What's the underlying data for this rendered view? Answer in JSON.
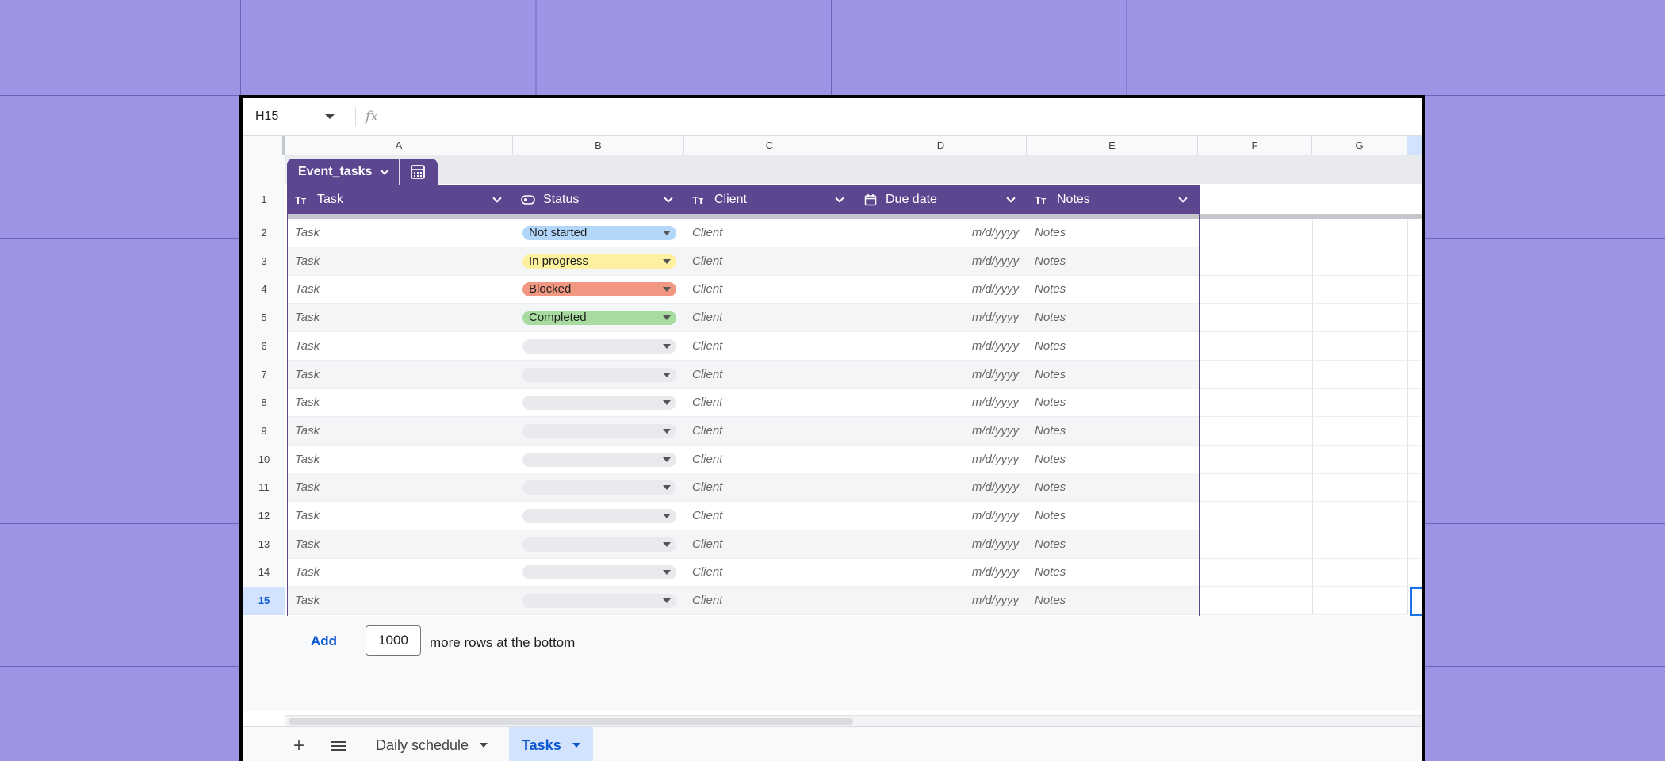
{
  "name_box": "H15",
  "formula_label": "fx",
  "columns": [
    "A",
    "B",
    "C",
    "D",
    "E",
    "F",
    "G"
  ],
  "table": {
    "name": "Event_tasks",
    "header_color": "#5c4690",
    "headers": [
      {
        "icon": "text-type-icon",
        "label": "Task"
      },
      {
        "icon": "chip-type-icon",
        "label": "Status"
      },
      {
        "icon": "text-type-icon",
        "label": "Client"
      },
      {
        "icon": "calendar-icon",
        "label": "Due date"
      },
      {
        "icon": "text-type-icon",
        "label": "Notes"
      }
    ],
    "header_row_num": "1",
    "rows": [
      {
        "num": "2",
        "task": "Task",
        "status": "Not started",
        "status_color": "#b3d7fb",
        "client": "Client",
        "due": "m/d/yyyy",
        "notes": "Notes"
      },
      {
        "num": "3",
        "task": "Task",
        "status": "In progress",
        "status_color": "#fdf19f",
        "client": "Client",
        "due": "m/d/yyyy",
        "notes": "Notes"
      },
      {
        "num": "4",
        "task": "Task",
        "status": "Blocked",
        "status_color": "#f29882",
        "client": "Client",
        "due": "m/d/yyyy",
        "notes": "Notes"
      },
      {
        "num": "5",
        "task": "Task",
        "status": "Completed",
        "status_color": "#a8dba0",
        "client": "Client",
        "due": "m/d/yyyy",
        "notes": "Notes"
      },
      {
        "num": "6",
        "task": "Task",
        "status": "",
        "status_color": "#e8eaed",
        "client": "Client",
        "due": "m/d/yyyy",
        "notes": "Notes"
      },
      {
        "num": "7",
        "task": "Task",
        "status": "",
        "status_color": "#e8eaed",
        "client": "Client",
        "due": "m/d/yyyy",
        "notes": "Notes"
      },
      {
        "num": "8",
        "task": "Task",
        "status": "",
        "status_color": "#e8eaed",
        "client": "Client",
        "due": "m/d/yyyy",
        "notes": "Notes"
      },
      {
        "num": "9",
        "task": "Task",
        "status": "",
        "status_color": "#e8eaed",
        "client": "Client",
        "due": "m/d/yyyy",
        "notes": "Notes"
      },
      {
        "num": "10",
        "task": "Task",
        "status": "",
        "status_color": "#e8eaed",
        "client": "Client",
        "due": "m/d/yyyy",
        "notes": "Notes"
      },
      {
        "num": "11",
        "task": "Task",
        "status": "",
        "status_color": "#e8eaed",
        "client": "Client",
        "due": "m/d/yyyy",
        "notes": "Notes"
      },
      {
        "num": "12",
        "task": "Task",
        "status": "",
        "status_color": "#e8eaed",
        "client": "Client",
        "due": "m/d/yyyy",
        "notes": "Notes"
      },
      {
        "num": "13",
        "task": "Task",
        "status": "",
        "status_color": "#e8eaed",
        "client": "Client",
        "due": "m/d/yyyy",
        "notes": "Notes"
      },
      {
        "num": "14",
        "task": "Task",
        "status": "",
        "status_color": "#e8eaed",
        "client": "Client",
        "due": "m/d/yyyy",
        "notes": "Notes"
      },
      {
        "num": "15",
        "task": "Task",
        "status": "",
        "status_color": "#e8eaed",
        "client": "Client",
        "due": "m/d/yyyy",
        "notes": "Notes"
      }
    ]
  },
  "add_rows": {
    "button": "Add",
    "count": "1000",
    "suffix": "more rows at the bottom"
  },
  "sheet_tabs": [
    {
      "label": "Daily schedule",
      "active": false
    },
    {
      "label": "Tasks",
      "active": true
    }
  ],
  "accent_color": "#1a73e8"
}
